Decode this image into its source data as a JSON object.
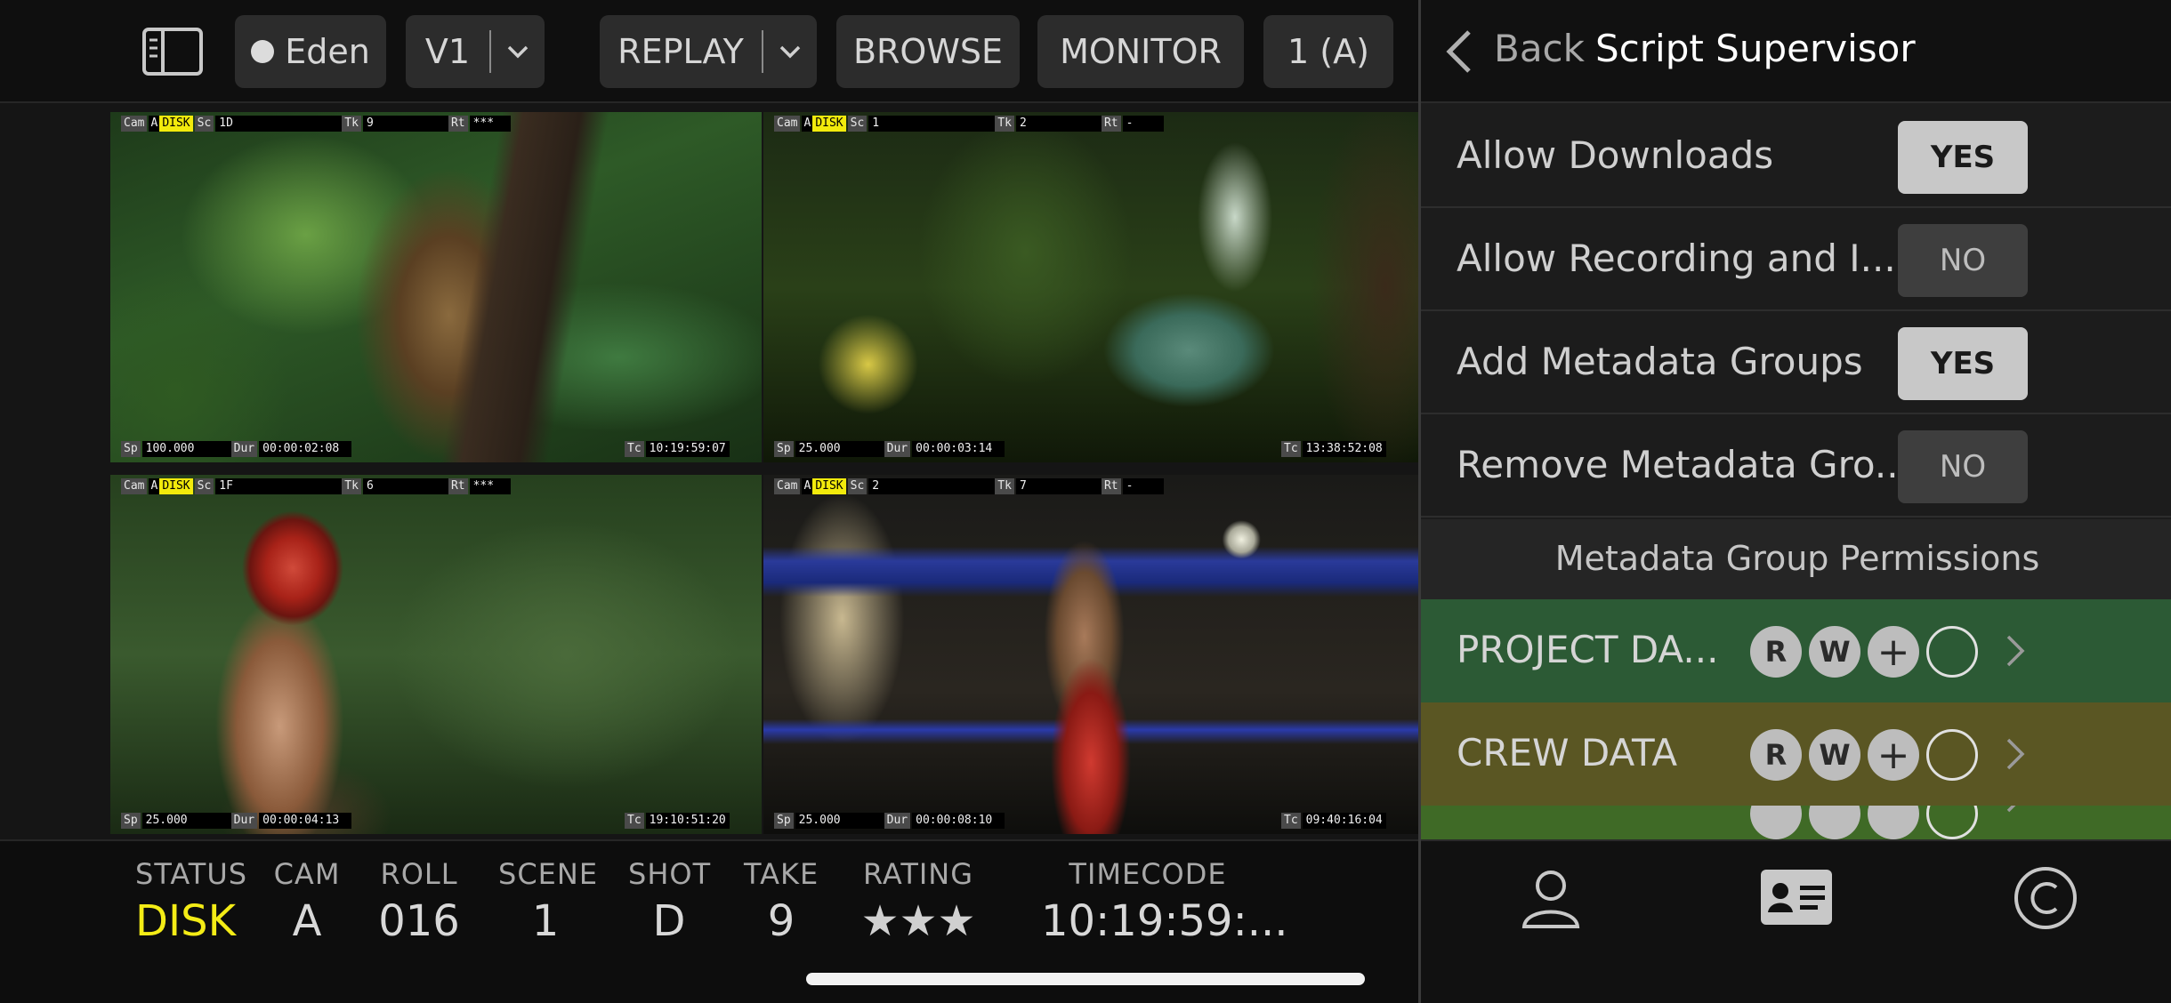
{
  "toolbar": {
    "sidebar_icon": "sidebar-toggle-icon",
    "project": "Eden",
    "version": "V1",
    "replay": "REPLAY",
    "browse": "BROWSE",
    "monitor": "MONITOR",
    "channel": "1 (A)"
  },
  "tiles": [
    {
      "cam_tag": "Cam",
      "cam": "A",
      "status": "DISK",
      "sc_tag": "Sc",
      "sc": "1D",
      "tk_tag": "Tk",
      "tk": "9",
      "rt_tag": "Rt",
      "rt": "***",
      "sp_tag": "Sp",
      "sp": "100.000",
      "dur_tag": "Dur",
      "dur": "00:00:02:08",
      "tc_tag": "Tc",
      "tc": "10:19:59:07"
    },
    {
      "cam_tag": "Cam",
      "cam": "A",
      "status": "DISK",
      "sc_tag": "Sc",
      "sc": "1",
      "tk_tag": "Tk",
      "tk": "2",
      "rt_tag": "Rt",
      "rt": "-",
      "sp_tag": "Sp",
      "sp": "25.000",
      "dur_tag": "Dur",
      "dur": "00:00:03:14",
      "tc_tag": "Tc",
      "tc": "13:38:52:08"
    },
    {
      "cam_tag": "Cam",
      "cam": "A",
      "status": "DISK",
      "sc_tag": "Sc",
      "sc": "1F",
      "tk_tag": "Tk",
      "tk": "6",
      "rt_tag": "Rt",
      "rt": "***",
      "sp_tag": "Sp",
      "sp": "25.000",
      "dur_tag": "Dur",
      "dur": "00:00:04:13",
      "tc_tag": "Tc",
      "tc": "19:10:51:20"
    },
    {
      "cam_tag": "Cam",
      "cam": "A",
      "status": "DISK",
      "sc_tag": "Sc",
      "sc": "2",
      "tk_tag": "Tk",
      "tk": "7",
      "rt_tag": "Rt",
      "rt": "-",
      "sp_tag": "Sp",
      "sp": "25.000",
      "dur_tag": "Dur",
      "dur": "00:00:08:10",
      "tc_tag": "Tc",
      "tc": "09:40:16:04"
    }
  ],
  "info": {
    "status_h": "STATUS",
    "status": "DISK",
    "cam_h": "CAM",
    "cam": "A",
    "roll_h": "ROLL",
    "roll": "016",
    "scene_h": "SCENE",
    "scene": "1",
    "shot_h": "SHOT",
    "shot": "D",
    "take_h": "TAKE",
    "take": "9",
    "rating_h": "RATING",
    "rating": "★★★",
    "timecode_h": "TIMECODE",
    "timecode": "10:19:59:..."
  },
  "panel": {
    "back": "Back",
    "title": "Script Supervisor",
    "settings": [
      {
        "label": "Allow Downloads",
        "value": "YES"
      },
      {
        "label": "Allow Recording and I...",
        "value": "NO"
      },
      {
        "label": "Add Metadata Groups",
        "value": "YES"
      },
      {
        "label": "Remove Metadata Gro...",
        "value": "NO"
      }
    ],
    "perm_header": "Metadata Group Permissions",
    "groups": [
      {
        "label": "PROJECT DA...",
        "r": "R",
        "w": "W",
        "add": "+",
        "color": "#2c5a35"
      },
      {
        "label": "CREW DATA",
        "r": "R",
        "w": "W",
        "add": "+",
        "color": "#5a5623"
      },
      {
        "label": "",
        "r": "",
        "w": "",
        "add": "",
        "color": "#3f6a26"
      }
    ],
    "tabs": [
      "user-icon",
      "contact-card-icon",
      "copyright-icon"
    ]
  },
  "colors": {
    "accent_yellow": "#f4ec16",
    "project_group": "#2c5a35",
    "crew_group": "#5a5623",
    "third_group": "#3f6a26"
  }
}
